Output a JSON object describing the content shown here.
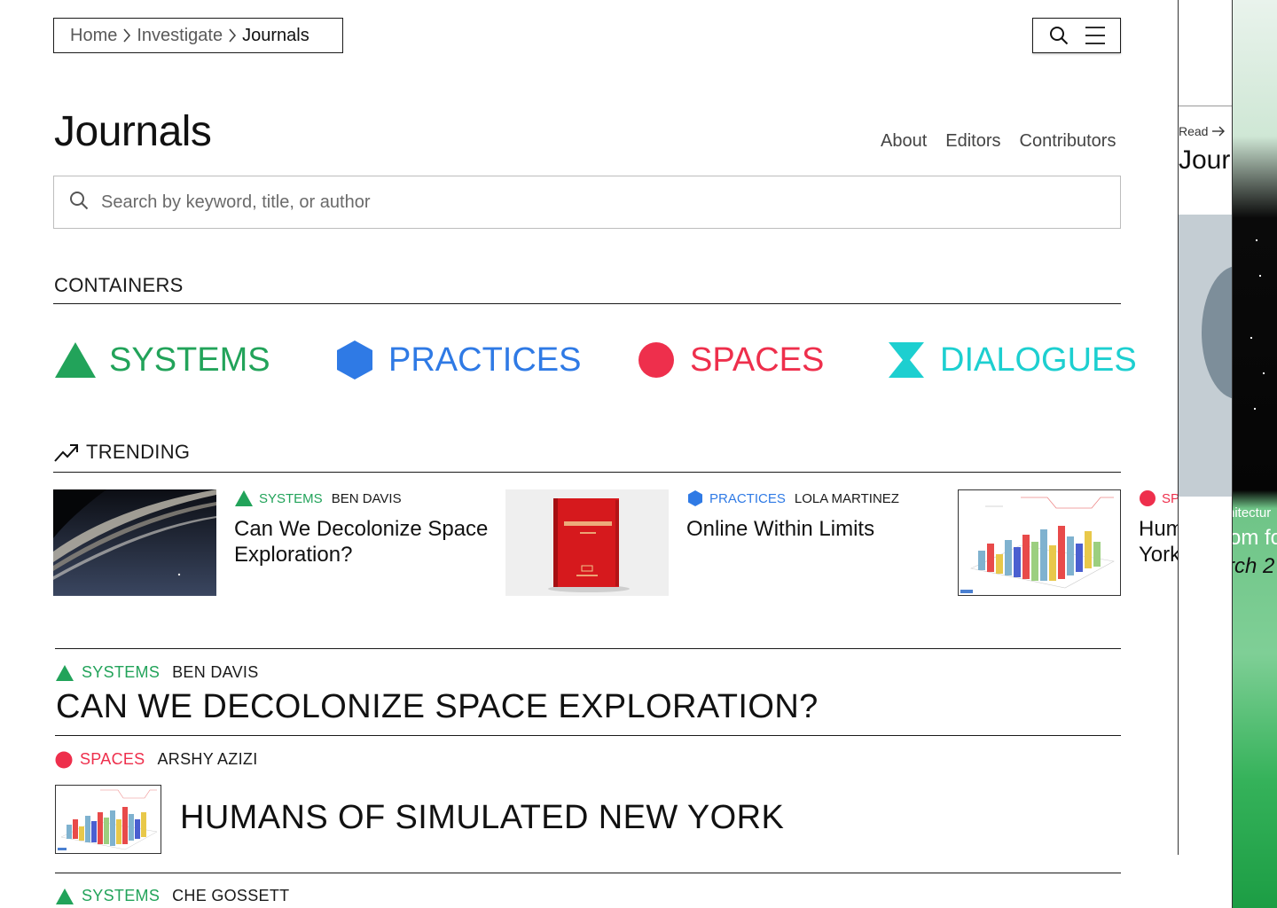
{
  "breadcrumb": {
    "home": "Home",
    "investigate": "Investigate",
    "current": "Journals"
  },
  "header": {
    "search_icon": "search-icon",
    "menu_icon": "menu-icon"
  },
  "page": {
    "title": "Journals",
    "nav": [
      "About",
      "Editors",
      "Contributors"
    ]
  },
  "search": {
    "placeholder": "Search by keyword, title, or author",
    "value": ""
  },
  "containers": {
    "heading": "CONTAINERS",
    "items": [
      {
        "label": "SYSTEMS",
        "icon": "triangle-icon",
        "color": "#22a35a"
      },
      {
        "label": "PRACTICES",
        "icon": "hexagon-icon",
        "color": "#2f7ae5"
      },
      {
        "label": "SPACES",
        "icon": "circle-icon",
        "color": "#ee2f4c"
      },
      {
        "label": "DIALOGUES",
        "icon": "hourglass-icon",
        "color": "#1dcfd0"
      }
    ]
  },
  "trending": {
    "heading": "TRENDING",
    "items": [
      {
        "tag": "SYSTEMS",
        "author": "BEN DAVIS",
        "title": "Can We Decolonize Space Exploration?",
        "image": "saturn-rings-image"
      },
      {
        "tag": "PRACTICES",
        "author": "LOLA MARTINEZ",
        "title": "Online Within Limits",
        "image": "red-book-image"
      },
      {
        "tag": "SP",
        "author": "",
        "title_line1": "Hum",
        "title_line2": "York",
        "image": "3d-bar-chart-image"
      }
    ]
  },
  "articles": [
    {
      "tag": "SYSTEMS",
      "author": "BEN DAVIS",
      "title": "CAN WE DECOLONIZE SPACE EXPLORATION?"
    },
    {
      "tag": "SPACES",
      "author": "ARSHY AZIZI",
      "title": "HUMANS OF SIMULATED NEW YORK",
      "image": "3d-bar-chart-image"
    },
    {
      "tag": "SYSTEMS",
      "author": "CHE GOSSETT"
    }
  ],
  "side_panel_a": {
    "read_label": "Read",
    "title_fragment": "Jour"
  },
  "side_panel_b": {
    "line1": "nitectur",
    "line2": "om fo",
    "line3": "rch 2"
  },
  "colors": {
    "systems": "#22a35a",
    "practices": "#2f7ae5",
    "spaces": "#ee2f4c",
    "dialogues": "#1dcfd0"
  }
}
